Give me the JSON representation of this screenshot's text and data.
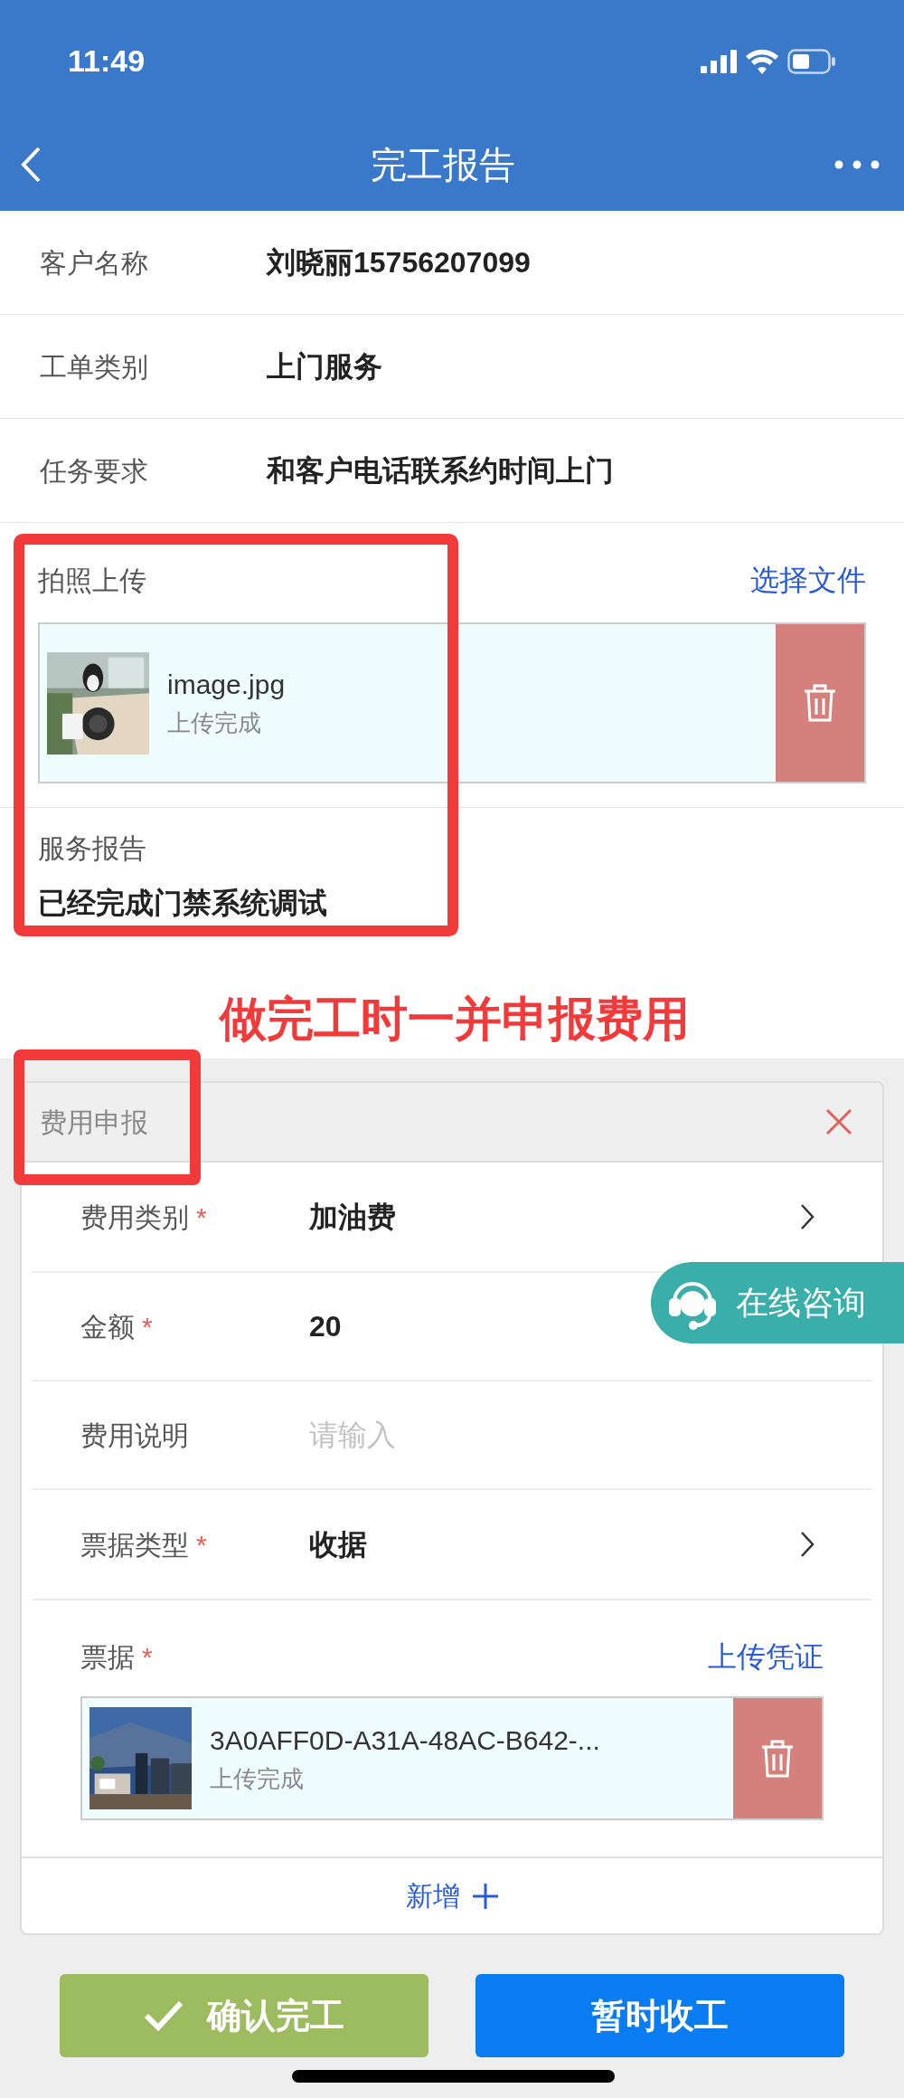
{
  "status_bar": {
    "time": "11:49"
  },
  "nav": {
    "title": "完工报告"
  },
  "info_rows": [
    {
      "label": "客户名称",
      "value": "刘晓丽15756207099"
    },
    {
      "label": "工单类别",
      "value": "上门服务"
    },
    {
      "label": "任务要求",
      "value": "和客户电话联系约时间上门"
    }
  ],
  "photo_upload": {
    "label": "拍照上传",
    "action": "选择文件",
    "files": [
      {
        "name": "image.jpg",
        "status": "上传完成"
      }
    ]
  },
  "service_report": {
    "label": "服务报告",
    "value": "已经完成门禁系统调试"
  },
  "annotation": {
    "text": "做完工时一并申报费用"
  },
  "expense_card": {
    "title": "费用申报",
    "fields": [
      {
        "kind": "select",
        "label": "费用类别",
        "required_mark": "*",
        "value": "加油费"
      },
      {
        "kind": "input",
        "label": "金额",
        "required_mark": "*",
        "value": "20"
      },
      {
        "kind": "input",
        "label": "费用说明",
        "placeholder": "请输入"
      },
      {
        "kind": "select",
        "label": "票据类型",
        "required_mark": "*",
        "value": "收据"
      },
      {
        "kind": "upload",
        "label": "票据",
        "required_mark": "*",
        "action": "上传凭证",
        "files": [
          {
            "name": "3A0AFF0D-A31A-48AC-B642-...",
            "status": "上传完成"
          }
        ]
      }
    ],
    "add_label": "新增"
  },
  "chat_button": {
    "label": "在线咨询"
  },
  "buttons": [
    {
      "kind": "confirm",
      "label": "确认完工"
    },
    {
      "kind": "primary",
      "label": "暂时收工"
    }
  ]
}
